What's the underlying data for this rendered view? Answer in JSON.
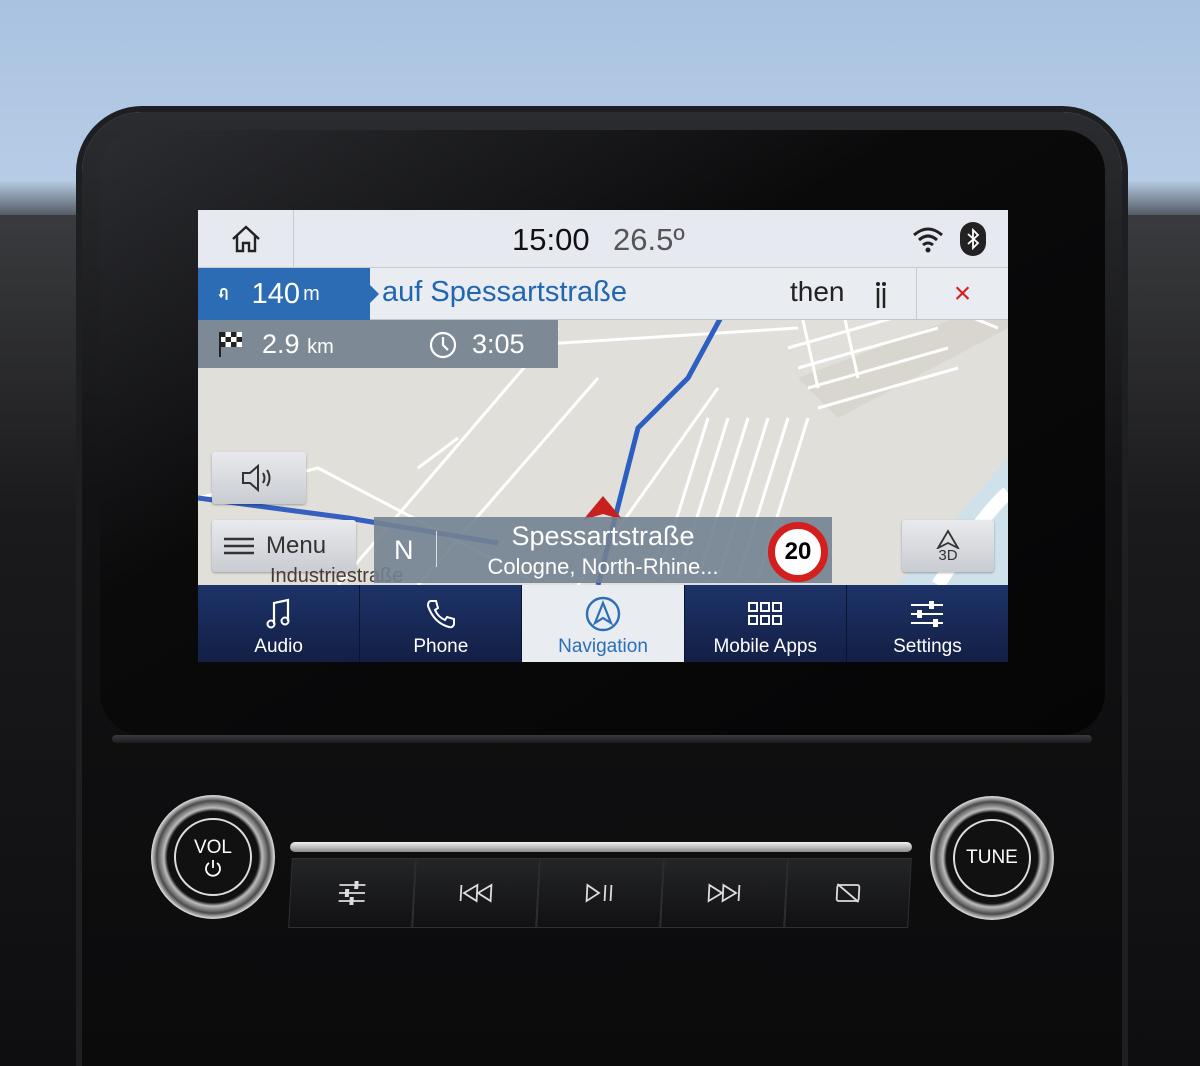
{
  "status": {
    "time": "15:00",
    "temperature": "26.5º",
    "icons": [
      "home-icon",
      "wifi-icon",
      "bluetooth-icon"
    ]
  },
  "guidance": {
    "maneuver": "u-turn-left",
    "distance": "140",
    "distance_unit": "m",
    "street": "auf Spessartstraße",
    "then_label": "then",
    "close_label": "×"
  },
  "trip": {
    "remaining_distance": "2.9",
    "remaining_unit": "km",
    "eta": "3:05"
  },
  "map": {
    "menu_label": "Menu",
    "heading": "N",
    "current_street": "Spessartstraße",
    "current_location": "Cologne, North-Rhine...",
    "speed_limit": "20",
    "view_mode": "3D",
    "street_label": "Industriestraße",
    "route_color": "#2c5fc0"
  },
  "tabs": [
    {
      "label": "Audio",
      "icon": "music-note-icon"
    },
    {
      "label": "Phone",
      "icon": "phone-icon"
    },
    {
      "label": "Navigation",
      "icon": "navigation-icon",
      "active": true
    },
    {
      "label": "Mobile Apps",
      "icon": "apps-grid-icon"
    },
    {
      "label": "Settings",
      "icon": "sliders-icon"
    }
  ],
  "hardware": {
    "vol_label": "VOL",
    "tune_label": "TUNE"
  },
  "colors": {
    "accent": "#2c6cb5",
    "tab_bar": "#1d3368",
    "close": "#d32020",
    "speed_ring": "#d41f1f"
  }
}
